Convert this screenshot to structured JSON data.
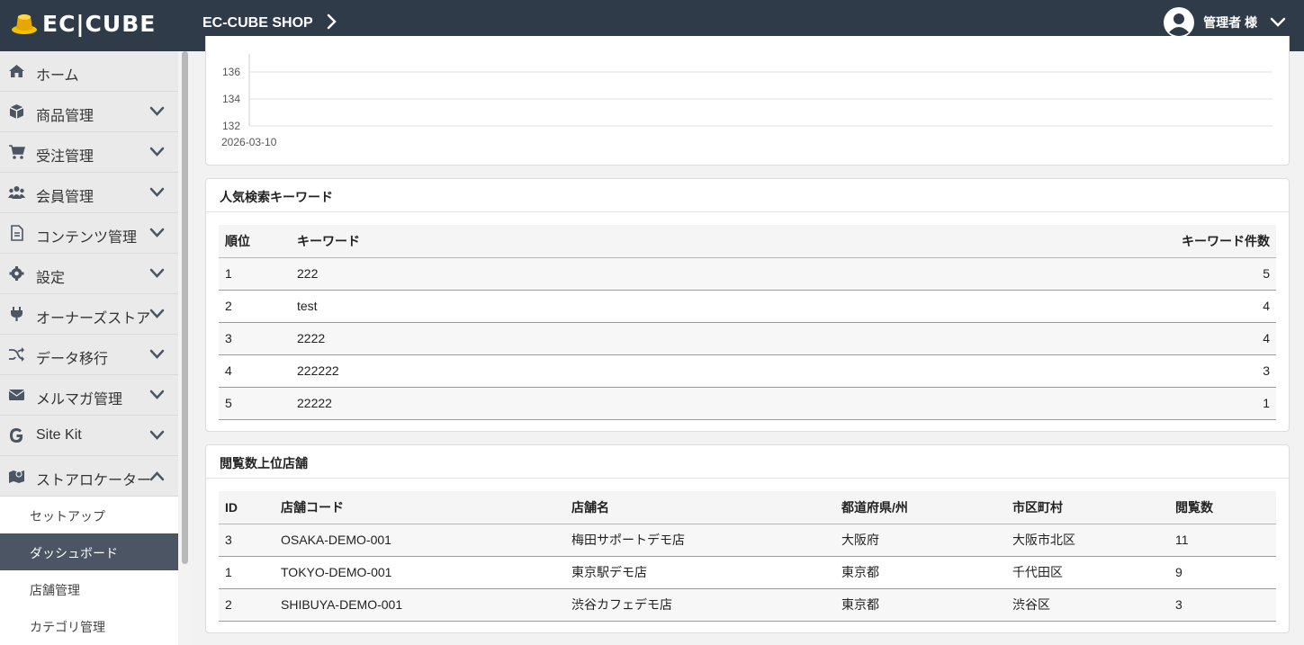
{
  "header": {
    "logo_text": "EC|CUBE",
    "shop_name": "EC-CUBE SHOP",
    "admin_name": "管理者 様",
    "bg_color": "#2f3b48"
  },
  "sidebar": {
    "items": [
      {
        "label": "ホーム",
        "icon": "home-icon",
        "has_chevron": false
      },
      {
        "label": "商品管理",
        "icon": "box-icon",
        "has_chevron": true
      },
      {
        "label": "受注管理",
        "icon": "cart-icon",
        "has_chevron": true
      },
      {
        "label": "会員管理",
        "icon": "users-icon",
        "has_chevron": true
      },
      {
        "label": "コンテンツ管理",
        "icon": "file-icon",
        "has_chevron": true
      },
      {
        "label": "設定",
        "icon": "gear-icon",
        "has_chevron": true
      },
      {
        "label": "オーナーズストア",
        "icon": "plug-icon",
        "has_chevron": true
      },
      {
        "label": "データ移行",
        "icon": "shuffle-icon",
        "has_chevron": true
      },
      {
        "label": "メルマガ管理",
        "icon": "envelope-icon",
        "has_chevron": true
      },
      {
        "label": "Site Kit",
        "icon": "google-icon",
        "has_chevron": true
      },
      {
        "label": "ストアロケーター",
        "icon": "map-icon",
        "has_chevron": true,
        "expanded": true
      }
    ],
    "sub_items": [
      {
        "label": "セットアップ",
        "active": false
      },
      {
        "label": "ダッシュボード",
        "active": true
      },
      {
        "label": "店舗管理",
        "active": false
      },
      {
        "label": "カテゴリ管理",
        "active": false
      }
    ]
  },
  "chart_data": {
    "type": "line",
    "x": [
      "2026-03-10"
    ],
    "y_ticks": [
      136,
      134,
      132
    ],
    "ylim": [
      132,
      137
    ],
    "series": [],
    "grid": true
  },
  "keywords": {
    "title": "人気検索キーワード",
    "columns": [
      "順位",
      "キーワード",
      "キーワード件数"
    ],
    "rows": [
      [
        "1",
        "222",
        "5"
      ],
      [
        "2",
        "test",
        "4"
      ],
      [
        "3",
        "2222",
        "4"
      ],
      [
        "4",
        "222222",
        "3"
      ],
      [
        "5",
        "22222",
        "1"
      ]
    ]
  },
  "stores": {
    "title": "閲覧数上位店舗",
    "columns": [
      "ID",
      "店舗コード",
      "店舗名",
      "都道府県/州",
      "市区町村",
      "閲覧数"
    ],
    "rows": [
      [
        "3",
        "OSAKA-DEMO-001",
        "梅田サポートデモ店",
        "大阪府",
        "大阪市北区",
        "11"
      ],
      [
        "1",
        "TOKYO-DEMO-001",
        "東京駅デモ店",
        "東京都",
        "千代田区",
        "9"
      ],
      [
        "2",
        "SHIBUYA-DEMO-001",
        "渋谷カフェデモ店",
        "東京都",
        "渋谷区",
        "3"
      ]
    ]
  }
}
